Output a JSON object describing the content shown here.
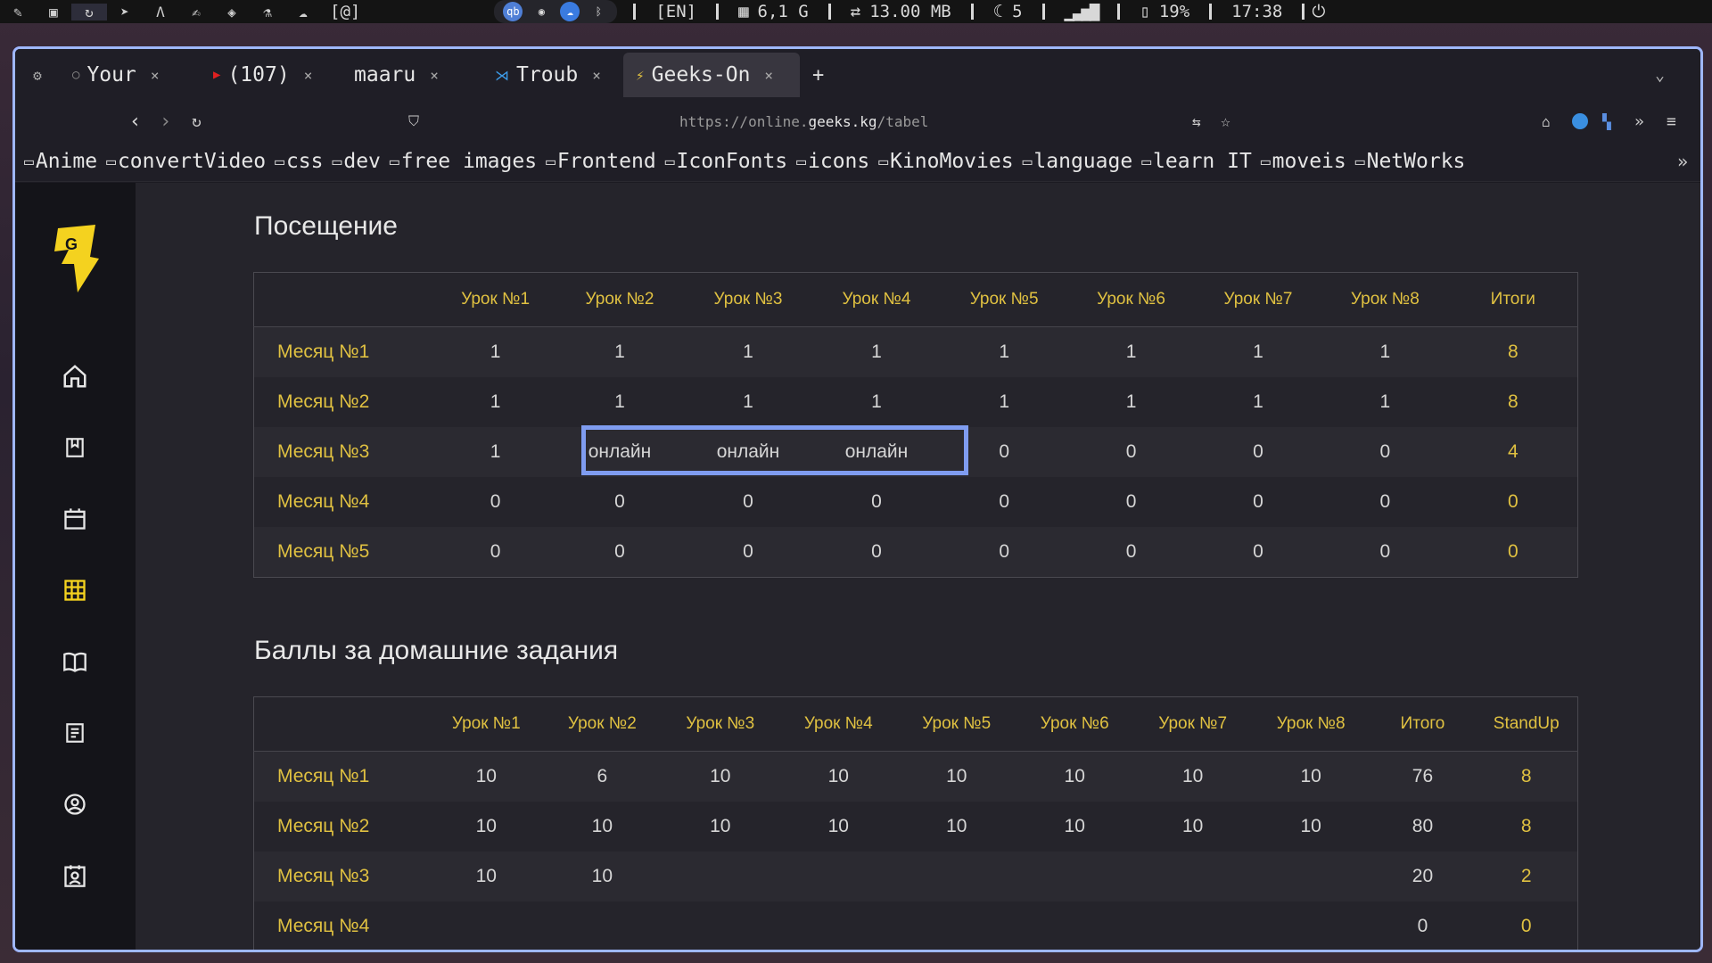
{
  "sysbar": {
    "kbd_lang": "[EN]",
    "memory": "6,1 G",
    "net": "13.00 MB",
    "moon_count": "5",
    "battery": "19%",
    "time": "17:38",
    "workspace_label": "[@]"
  },
  "browser": {
    "tabs": [
      {
        "label": "Your"
      },
      {
        "label": "(107)"
      },
      {
        "label": "maaru"
      },
      {
        "label": "Troub"
      },
      {
        "label": "Geeks-On"
      }
    ],
    "url_prefix": "https://online.",
    "url_domain": "geeks.kg",
    "url_path": "/tabel",
    "bookmarks": [
      "Anime",
      "convertVideo",
      "css",
      "dev",
      "free images",
      "Frontend",
      "IconFonts",
      "icons",
      "KinoMovies",
      "language",
      "learn IT",
      "moveis",
      "NetWorks"
    ]
  },
  "attendance": {
    "title": "Посещение",
    "headers": [
      "",
      "Урок №1",
      "Урок №2",
      "Урок №3",
      "Урок №4",
      "Урок №5",
      "Урок №6",
      "Урок №7",
      "Урок №8",
      "Итоги"
    ],
    "rows": [
      {
        "month": "Месяц №1",
        "cells": [
          "1",
          "1",
          "1",
          "1",
          "1",
          "1",
          "1",
          "1"
        ],
        "total": "8"
      },
      {
        "month": "Месяц №2",
        "cells": [
          "1",
          "1",
          "1",
          "1",
          "1",
          "1",
          "1",
          "1"
        ],
        "total": "8"
      },
      {
        "month": "Месяц №3",
        "cells": [
          "1",
          "онлайн",
          "онлайн",
          "онлайн",
          "0",
          "0",
          "0",
          "0"
        ],
        "total": "4"
      },
      {
        "month": "Месяц №4",
        "cells": [
          "0",
          "0",
          "0",
          "0",
          "0",
          "0",
          "0",
          "0"
        ],
        "total": "0"
      },
      {
        "month": "Месяц №5",
        "cells": [
          "0",
          "0",
          "0",
          "0",
          "0",
          "0",
          "0",
          "0"
        ],
        "total": "0"
      }
    ]
  },
  "homework": {
    "title": "Баллы за домашние задания",
    "headers": [
      "",
      "Урок №1",
      "Урок №2",
      "Урок №3",
      "Урок №4",
      "Урок №5",
      "Урок №6",
      "Урок №7",
      "Урок №8",
      "Итого",
      "StandUp"
    ],
    "rows": [
      {
        "month": "Месяц №1",
        "cells": [
          "10",
          "6",
          "10",
          "10",
          "10",
          "10",
          "10",
          "10"
        ],
        "total": "76",
        "standup": "8"
      },
      {
        "month": "Месяц №2",
        "cells": [
          "10",
          "10",
          "10",
          "10",
          "10",
          "10",
          "10",
          "10"
        ],
        "total": "80",
        "standup": "8"
      },
      {
        "month": "Месяц №3",
        "cells": [
          "10",
          "10",
          "",
          "",
          "",
          "",
          "",
          ""
        ],
        "total": "20",
        "standup": "2"
      },
      {
        "month": "Месяц №4",
        "cells": [
          "",
          "",
          "",
          "",
          "",
          "",
          "",
          ""
        ],
        "total": "0",
        "standup": "0"
      }
    ]
  },
  "colors": {
    "accent": "#e0c141",
    "highlight": "#7f9cf0",
    "window_border": "#9fb7ff"
  }
}
